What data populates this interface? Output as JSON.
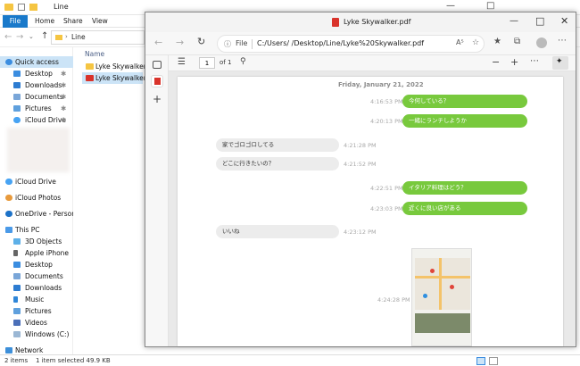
{
  "explorer": {
    "title": "Line",
    "ribbon_tabs": [
      "File",
      "Home",
      "Share",
      "View"
    ],
    "address": "Line",
    "column_header": "Name",
    "files": [
      {
        "name": "Lyke Skywalker",
        "icon": "folder-icon"
      },
      {
        "name": "Lyke Skywalker",
        "icon": "pdf-file-icon"
      }
    ],
    "nav": [
      {
        "label": "Quick access",
        "icon": "star-icon"
      },
      {
        "label": "Desktop",
        "icon": "desktop-icon",
        "pinned": true
      },
      {
        "label": "Downloads",
        "icon": "download-icon",
        "pinned": true
      },
      {
        "label": "Documents",
        "icon": "documents-icon",
        "pinned": true
      },
      {
        "label": "Pictures",
        "icon": "pictures-icon",
        "pinned": true
      },
      {
        "label": "iCloud Drive",
        "icon": "cloud-icon",
        "pinned": true
      },
      {
        "label": "iCloud Drive",
        "icon": "cloud-icon"
      },
      {
        "label": "iCloud Photos",
        "icon": "photos-icon"
      },
      {
        "label": "OneDrive - Person",
        "icon": "onedrive-icon"
      },
      {
        "label": "This PC",
        "icon": "pc-icon"
      },
      {
        "label": "3D Objects",
        "icon": "cube-icon"
      },
      {
        "label": "Apple iPhone",
        "icon": "phone-icon"
      },
      {
        "label": "Desktop",
        "icon": "desktop-icon"
      },
      {
        "label": "Documents",
        "icon": "documents-icon"
      },
      {
        "label": "Downloads",
        "icon": "download-icon"
      },
      {
        "label": "Music",
        "icon": "music-icon"
      },
      {
        "label": "Pictures",
        "icon": "pictures-icon"
      },
      {
        "label": "Videos",
        "icon": "videos-icon"
      },
      {
        "label": "Windows (C:)",
        "icon": "drive-icon"
      },
      {
        "label": "Network",
        "icon": "network-icon"
      }
    ],
    "status": {
      "items": "2 items",
      "selected": "1 item selected  49.9 KB"
    }
  },
  "edge": {
    "tab_title": "Lyke Skywalker.pdf",
    "url_scheme": "File",
    "url": "C:/Users/          /Desktop/Line/Lyke%20Skywalker.pdf",
    "page_current": "1",
    "page_total": "of 1"
  },
  "chat": {
    "date": "Friday, January 21, 2022",
    "messages": [
      {
        "side": "right",
        "text": "今何している？",
        "time": "4:16:53 PM"
      },
      {
        "side": "right",
        "text": "一緒にランチしようか",
        "time": "4:20:13 PM"
      },
      {
        "side": "left",
        "text": "家でゴロゴロしてる",
        "time": "4:21:28 PM"
      },
      {
        "side": "left",
        "text": "どこに行きたいの？",
        "time": "4:21:52 PM"
      },
      {
        "side": "right",
        "text": "イタリア料理はどう？",
        "time": "4:22:51 PM"
      },
      {
        "side": "right",
        "text": "近くに良い店がある",
        "time": "4:23:03 PM"
      },
      {
        "side": "left",
        "text": "いいね",
        "time": "4:23:12 PM"
      },
      {
        "side": "right-image",
        "text": "",
        "time": "4:24:28 PM"
      }
    ]
  },
  "colors": {
    "accent": "#1979ca",
    "bubble_green": "#78c93d",
    "bubble_gray": "#ececec"
  }
}
